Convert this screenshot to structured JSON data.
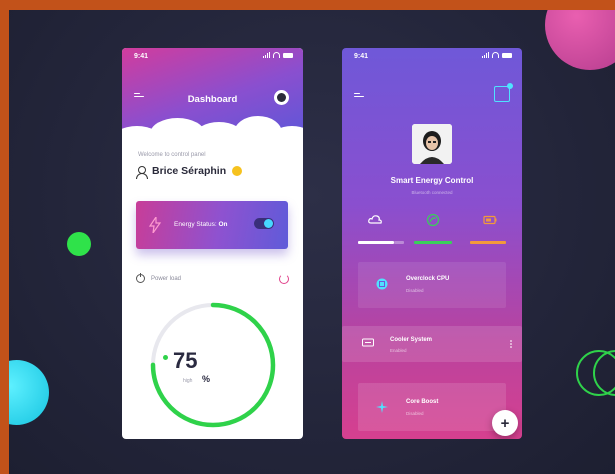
{
  "dashboard": {
    "status_time": "9:41",
    "title": "Dashboard",
    "welcome": "Welcome to control panel",
    "user_name": "Brice Séraphin",
    "energy_status_label": "Energy Status:",
    "energy_status_value": "On",
    "power_load_label": "Power load",
    "gauge": {
      "value": "75",
      "unit": "%",
      "sub": "high",
      "fraction": 0.75
    }
  },
  "energy": {
    "status_time": "9:41",
    "title": "Smart Energy Control",
    "subtitle": "Bluetooth connected",
    "tabs": [
      {
        "icon": "cloud-icon",
        "color": "#ffffff"
      },
      {
        "icon": "leaf-icon",
        "color": "#39d05a"
      },
      {
        "icon": "battery-icon",
        "color": "#f39a3a"
      }
    ],
    "items": [
      {
        "title": "Overclock CPU",
        "sub": "Disabled",
        "icon": "cpu-icon"
      },
      {
        "title": "Cooler System",
        "sub": "Enabled",
        "icon": "cooler-icon"
      },
      {
        "title": "Core Boost",
        "sub": "Disabled",
        "icon": "boost-icon"
      }
    ],
    "fab_label": "+"
  },
  "colors": {
    "accent_pink": "#d13c9d",
    "accent_purple": "#6f58d8",
    "gauge_green": "#2fd24a",
    "cyan": "#4fe3ff"
  }
}
